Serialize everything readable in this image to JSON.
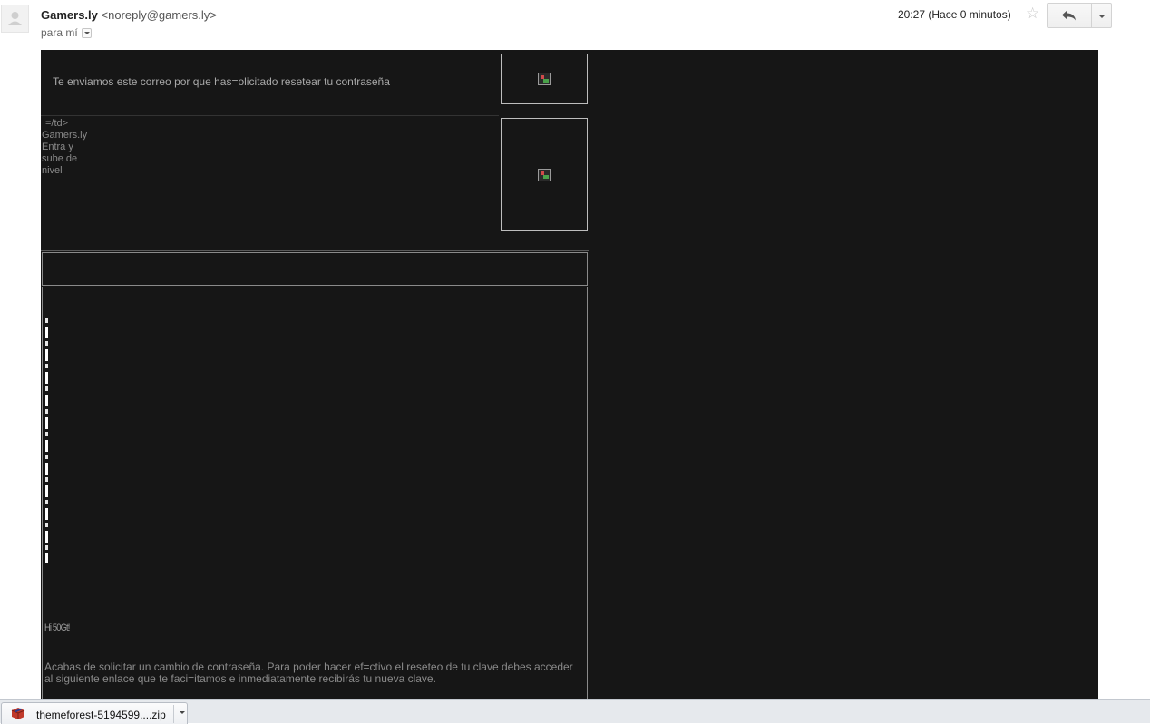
{
  "header": {
    "sender_name": "Gamers.ly",
    "sender_email": "<noreply@gamers.ly>",
    "recipient": "para mí",
    "timestamp": "20:27 (Hace 0 minutos)",
    "star_icon": "star-icon",
    "reply_icon": "reply-icon"
  },
  "email": {
    "intro": "Te enviamos este correo por que has=olicitado resetear tu contraseña",
    "raw_lines": [
      "=/td>",
      "Gamers.ly",
      "Entra y",
      "sube de",
      "nivel"
    ],
    "greeting": "Hi 50Gt!",
    "body_text": "Acabas de solicitar un cambio de contraseña. Para poder hacer ef=ctivo el reseteo de tu clave debes acceder al siguiente enlace que te faci=itamos e inmediatamente recibirás tu nueva clave.",
    "background": "#161616",
    "text_color": "#a9a9a9"
  },
  "downloads": {
    "file_name": "themeforest-5194599....zip",
    "file_icon": "zip-archive-icon"
  }
}
